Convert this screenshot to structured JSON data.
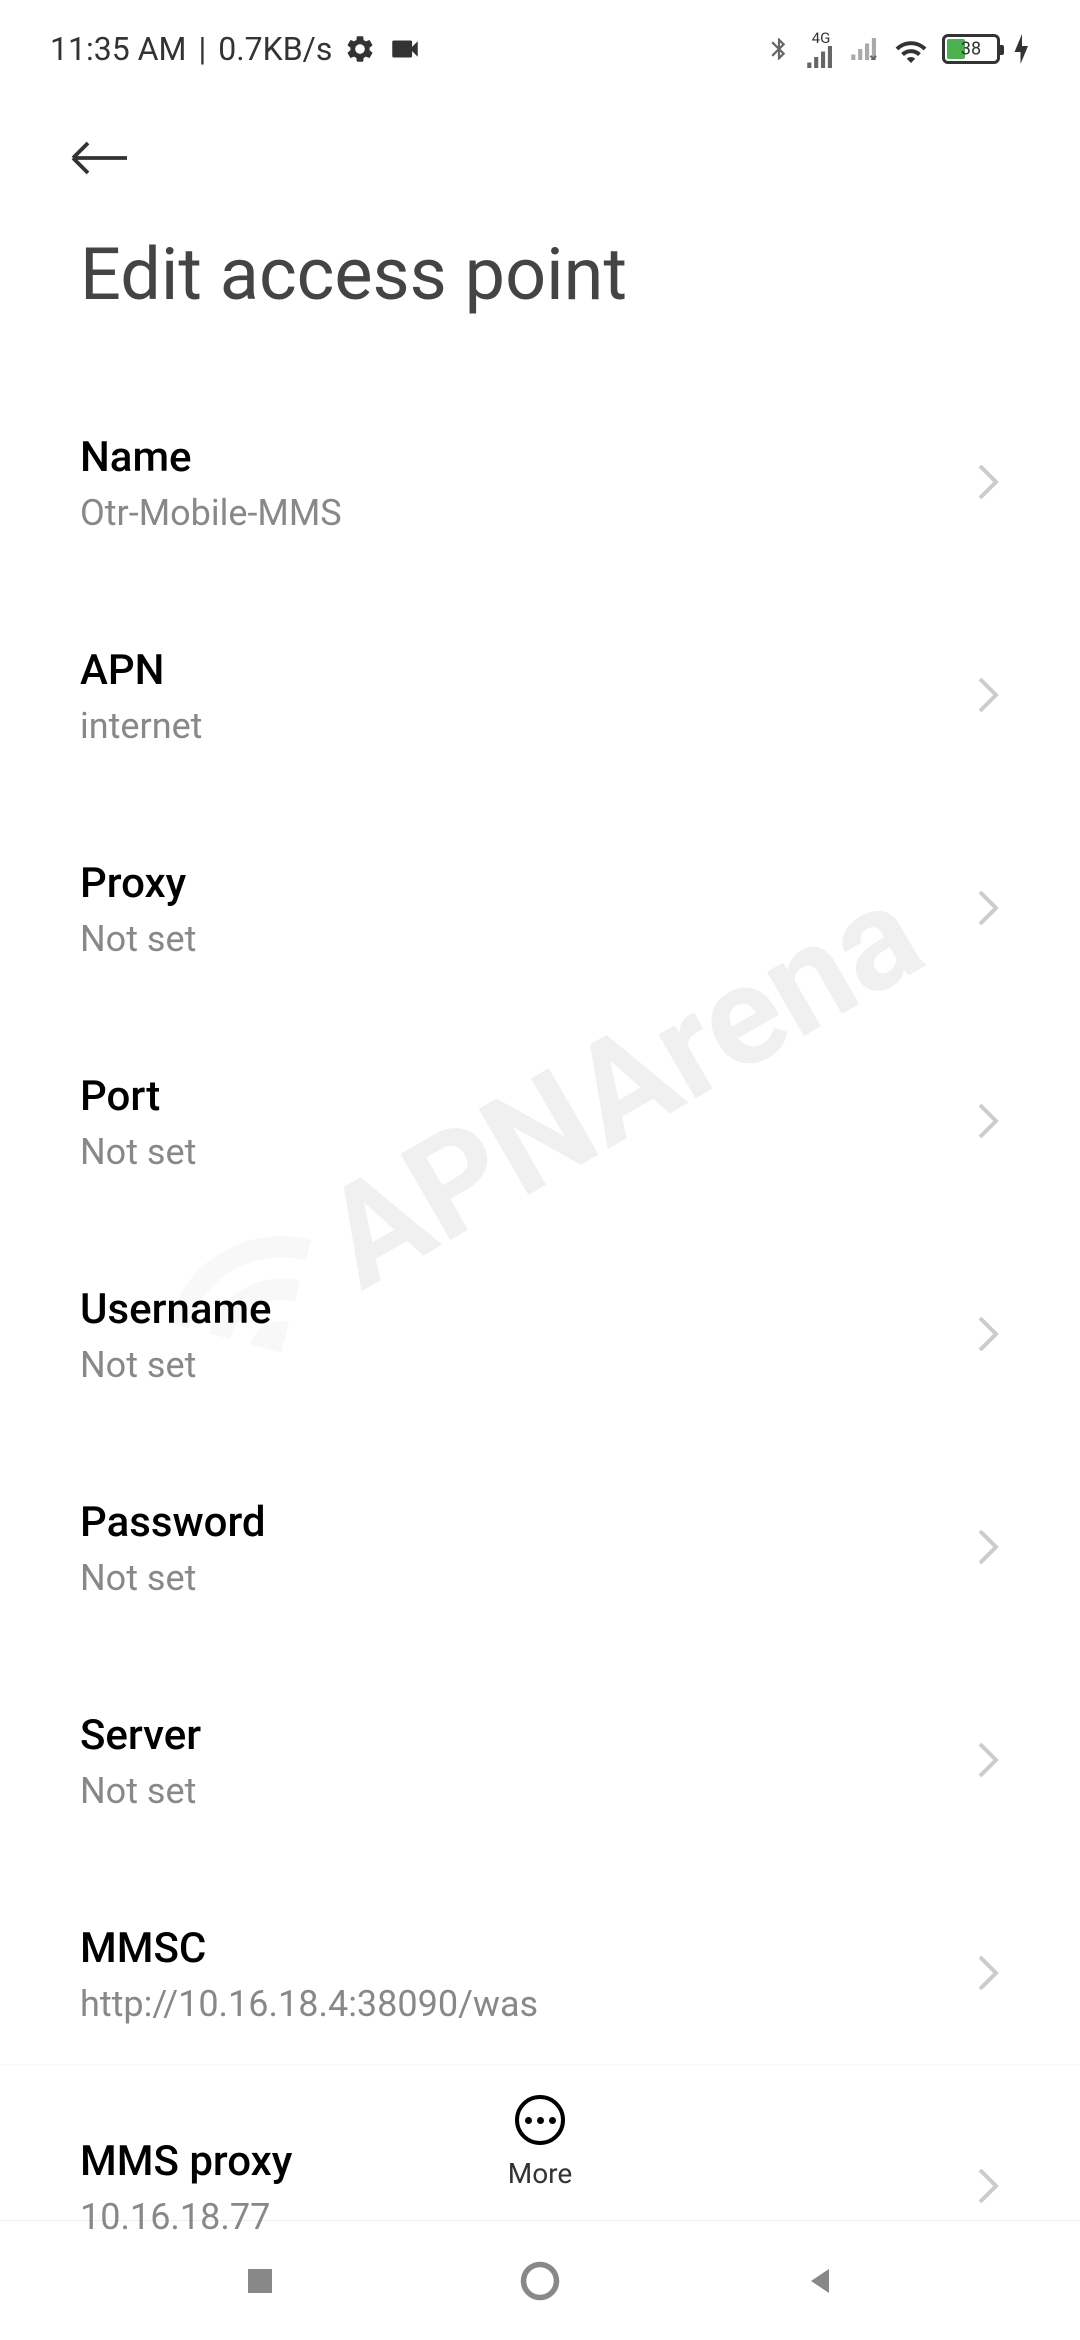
{
  "status_bar": {
    "time": "11:35 AM",
    "data_rate": "0.7KB/s",
    "signal_label": "4G",
    "battery_level": "38"
  },
  "page": {
    "title": "Edit access point"
  },
  "settings": [
    {
      "label": "Name",
      "value": "Otr-Mobile-MMS"
    },
    {
      "label": "APN",
      "value": "internet"
    },
    {
      "label": "Proxy",
      "value": "Not set"
    },
    {
      "label": "Port",
      "value": "Not set"
    },
    {
      "label": "Username",
      "value": "Not set"
    },
    {
      "label": "Password",
      "value": "Not set"
    },
    {
      "label": "Server",
      "value": "Not set"
    },
    {
      "label": "MMSC",
      "value": "http://10.16.18.4:38090/was"
    },
    {
      "label": "MMS proxy",
      "value": "10.16.18.77"
    }
  ],
  "bottom_bar": {
    "more_label": "More"
  },
  "watermark": "APNArena"
}
